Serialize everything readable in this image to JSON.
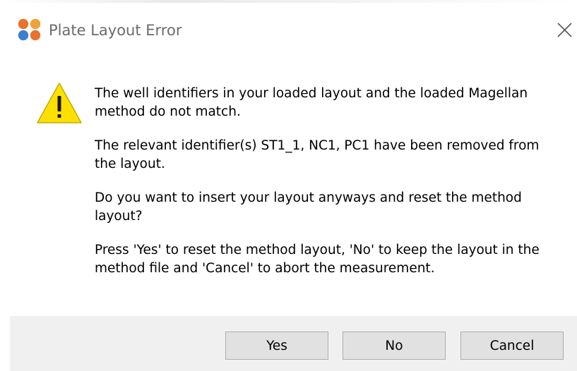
{
  "window": {
    "title": "Plate Layout Error",
    "app_icon": "colored-dots-app-icon",
    "close_icon": "close-icon"
  },
  "message": {
    "icon": "warning-icon",
    "paragraphs": [
      "The well identifiers in your loaded layout and the loaded Magellan method do not match.",
      "The relevant identifier(s) ST1_1, NC1, PC1 have been removed from the layout.",
      "Do you want to insert your layout anyways and reset the method layout?",
      "Press 'Yes' to reset the method layout, 'No' to keep the layout in the method file and 'Cancel' to abort the measurement."
    ]
  },
  "buttons": {
    "yes_label": "Yes",
    "no_label": "No",
    "cancel_label": "Cancel"
  },
  "colors": {
    "warning_fill": "#fce100",
    "warning_stroke": "#c8a800",
    "button_bar": "#f0f0f0",
    "button_face": "#e1e1e1",
    "button_border": "#adadad"
  }
}
